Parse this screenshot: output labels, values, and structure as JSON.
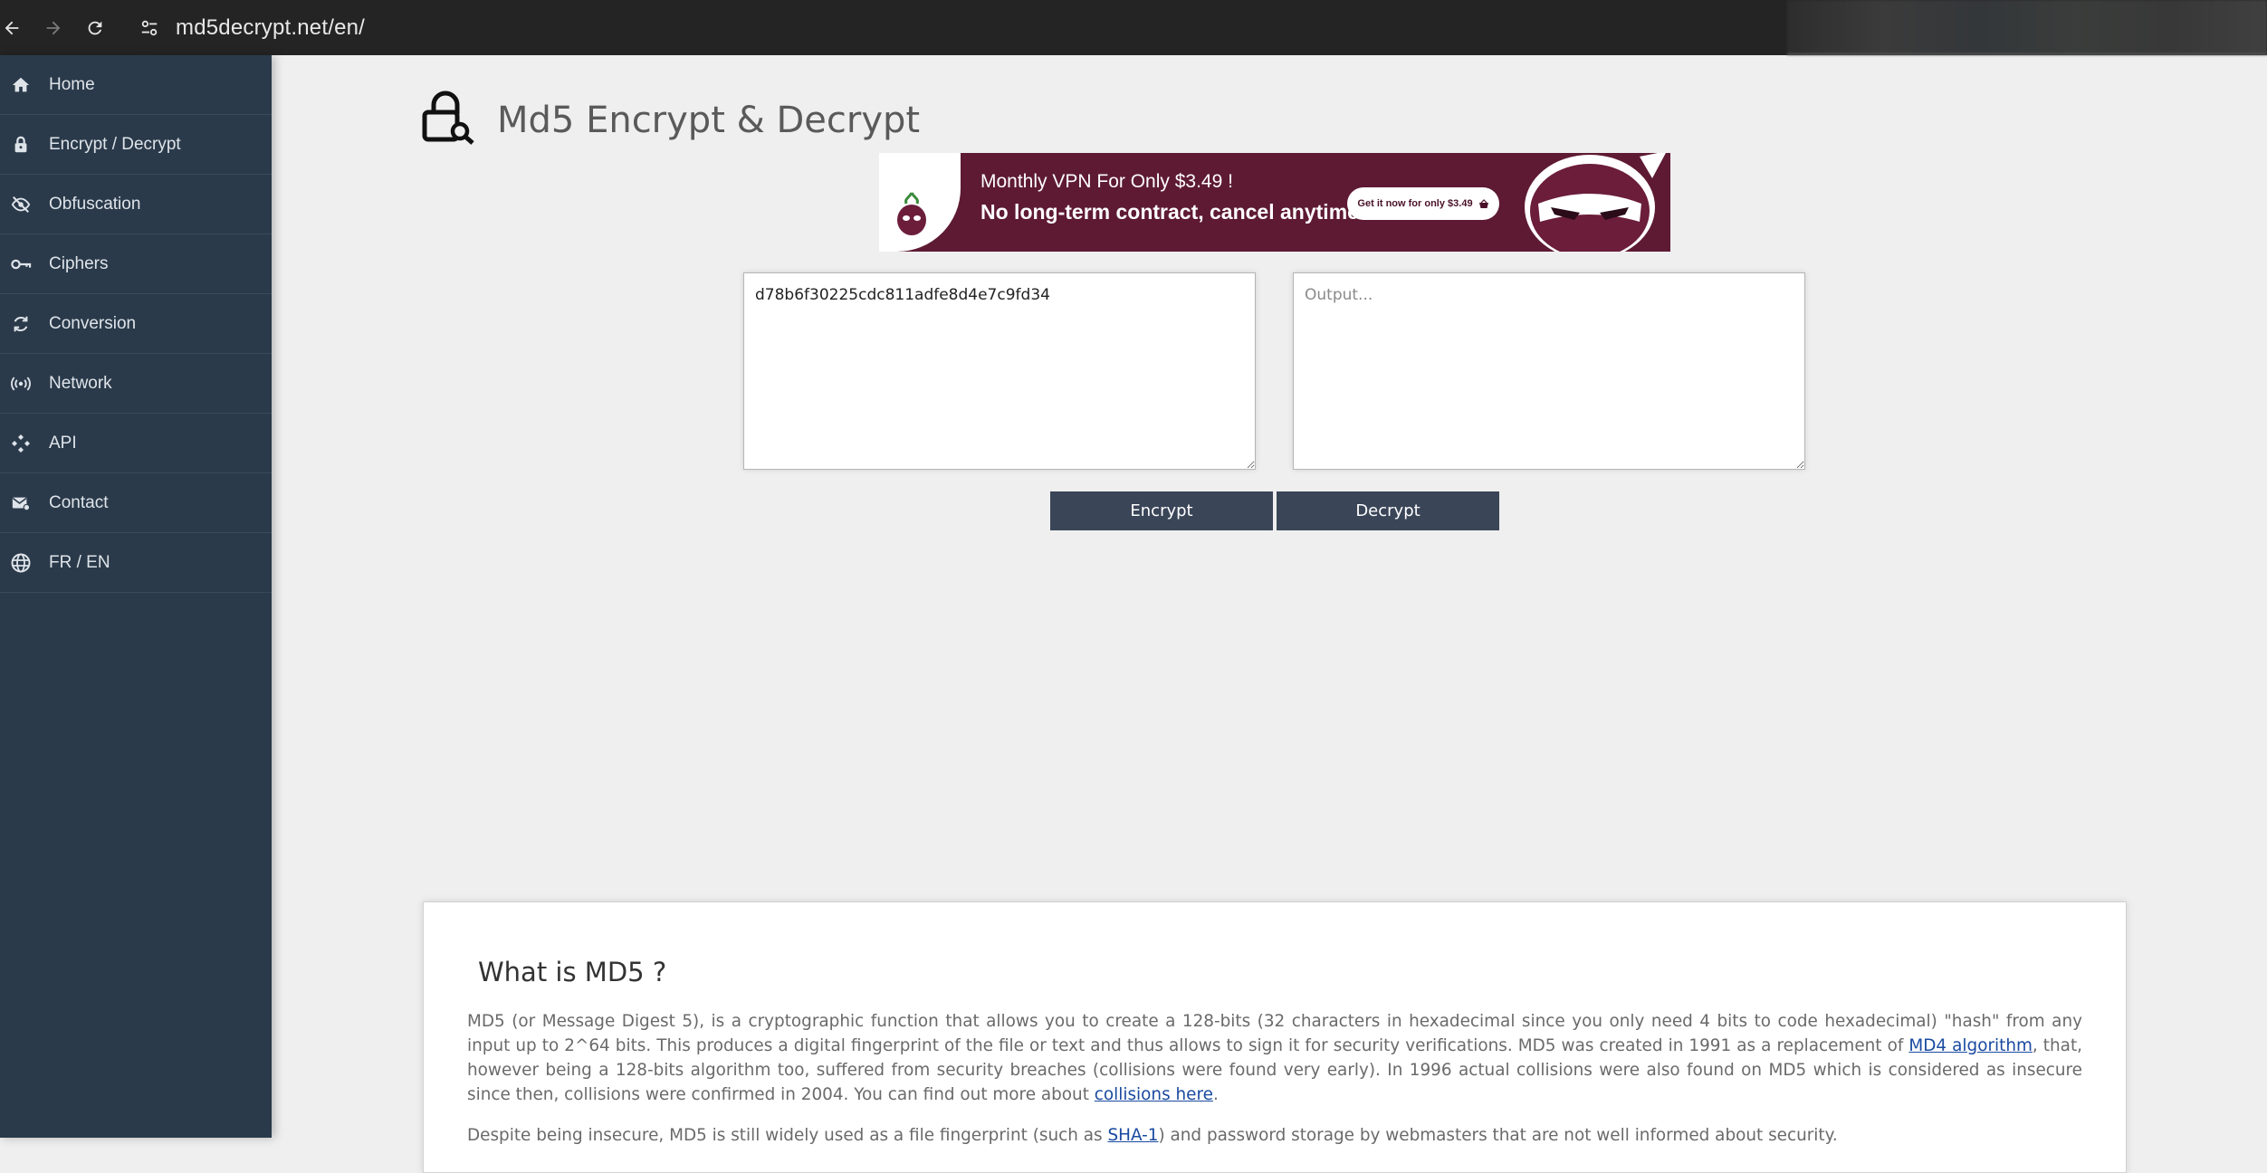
{
  "browser": {
    "url": "md5decrypt.net/en/"
  },
  "sidebar": {
    "items": [
      {
        "label": "Home",
        "icon": "home-icon"
      },
      {
        "label": "Encrypt / Decrypt",
        "icon": "lock-icon"
      },
      {
        "label": "Obfuscation",
        "icon": "eye-slash-icon"
      },
      {
        "label": "Ciphers",
        "icon": "key-icon"
      },
      {
        "label": "Conversion",
        "icon": "sync-icon"
      },
      {
        "label": "Network",
        "icon": "broadcast-icon"
      },
      {
        "label": "API",
        "icon": "api-icon"
      },
      {
        "label": "Contact",
        "icon": "mail-icon"
      },
      {
        "label": "FR / EN",
        "icon": "globe-icon"
      }
    ]
  },
  "header": {
    "title": "Md5 Encrypt & Decrypt"
  },
  "ad": {
    "line1": "Monthly VPN For Only $3.49 !",
    "line2": "No long-term contract, cancel anytime !",
    "cta": "Get it now for only $3.49"
  },
  "tool": {
    "input_value": "d78b6f30225cdc811adfe8d4e7c9fd34",
    "output_placeholder": "Output...",
    "encrypt_label": "Encrypt",
    "decrypt_label": "Decrypt"
  },
  "info": {
    "title": "What is MD5 ?",
    "p1_a": "MD5 (or Message Digest 5), is a cryptographic function that allows you to create a 128-bits (32 characters in hexadecimal since you only need 4 bits to code hexadecimal) \"hash\" from any input up to 2^64 bits. This produces a digital fingerprint of the file or text and thus allows to sign it for security verifications. MD5 was created in 1991 as a replacement of ",
    "p1_link1": "MD4 algorithm",
    "p1_b": ", that, however being a 128-bits algorithm too, suffered from security breaches (collisions were found very early). In 1996 actual collisions were also found on MD5 which is considered as insecure since then, collisions were confirmed in 2004. You can find out more about ",
    "p1_link2": "collisions here",
    "p1_c": ".",
    "p2_a": "Despite being insecure, MD5 is still widely used as a file fingerprint (such as ",
    "p2_link": "SHA-1",
    "p2_b": ") and password storage by webmasters that are not well informed about security."
  }
}
